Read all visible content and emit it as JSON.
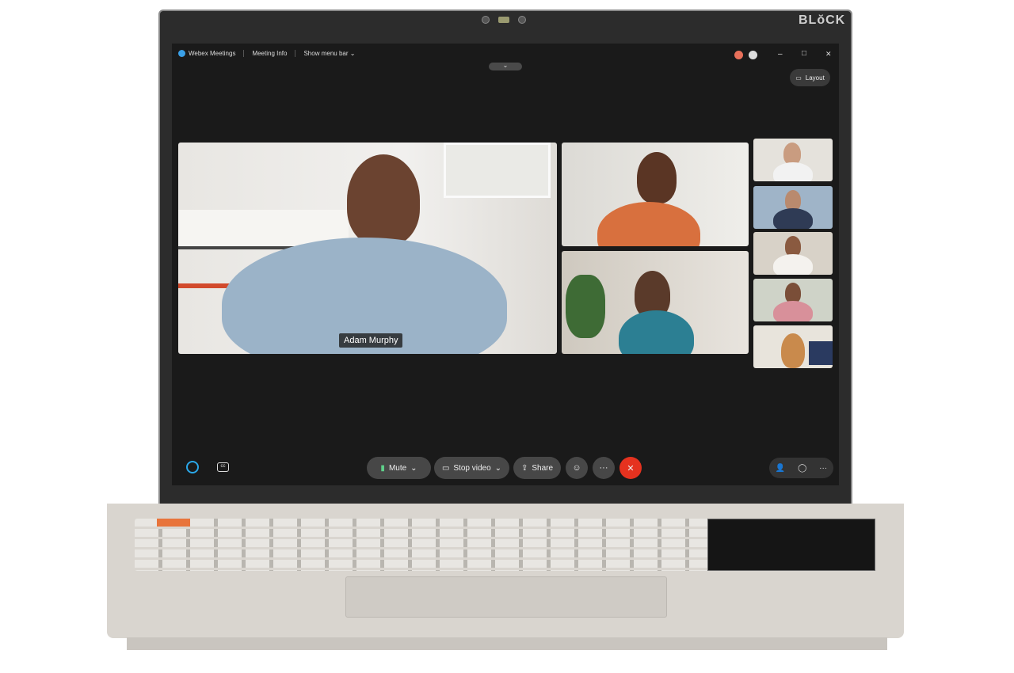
{
  "device": {
    "brand": "BLŏCK"
  },
  "titlebar": {
    "app_name": "Webex Meetings",
    "meeting_info": "Meeting Info",
    "show_menu_bar": "Show menu bar",
    "chevron": "⌄",
    "minimize": "–",
    "maximize": "□",
    "close": "✕"
  },
  "layout_button": {
    "label": "Layout"
  },
  "main_video": {
    "name_label": "Adam Murphy"
  },
  "controls": {
    "mute": "Mute",
    "stop_video": "Stop video",
    "share": "Share",
    "more": "···",
    "end": "✕",
    "caret": "⌄"
  },
  "colors": {
    "end_call": "#e5321f",
    "accent": "#1d9bf0",
    "keyboard_accent": "#e8743b"
  }
}
